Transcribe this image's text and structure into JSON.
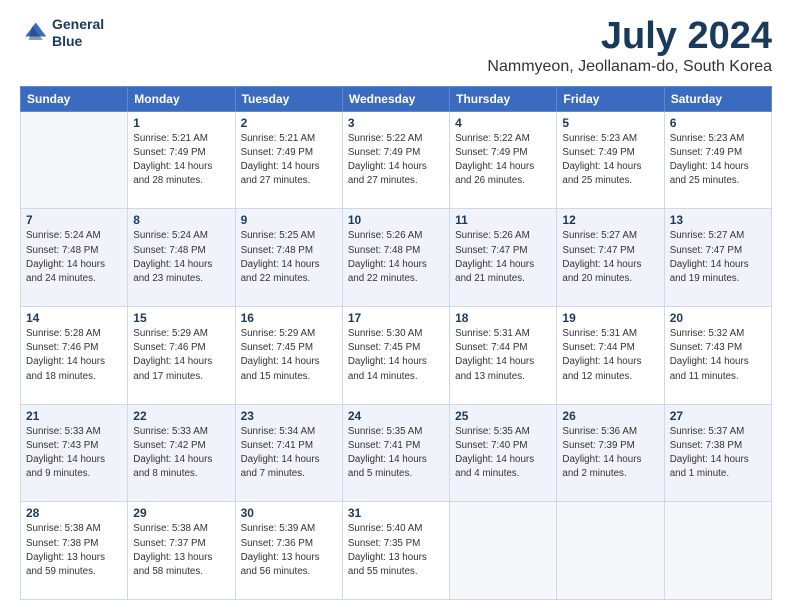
{
  "logo": {
    "line1": "General",
    "line2": "Blue"
  },
  "title": "July 2024",
  "subtitle": "Nammyeon, Jeollanam-do, South Korea",
  "headers": [
    "Sunday",
    "Monday",
    "Tuesday",
    "Wednesday",
    "Thursday",
    "Friday",
    "Saturday"
  ],
  "weeks": [
    [
      {
        "day": "",
        "info": ""
      },
      {
        "day": "1",
        "info": "Sunrise: 5:21 AM\nSunset: 7:49 PM\nDaylight: 14 hours\nand 28 minutes."
      },
      {
        "day": "2",
        "info": "Sunrise: 5:21 AM\nSunset: 7:49 PM\nDaylight: 14 hours\nand 27 minutes."
      },
      {
        "day": "3",
        "info": "Sunrise: 5:22 AM\nSunset: 7:49 PM\nDaylight: 14 hours\nand 27 minutes."
      },
      {
        "day": "4",
        "info": "Sunrise: 5:22 AM\nSunset: 7:49 PM\nDaylight: 14 hours\nand 26 minutes."
      },
      {
        "day": "5",
        "info": "Sunrise: 5:23 AM\nSunset: 7:49 PM\nDaylight: 14 hours\nand 25 minutes."
      },
      {
        "day": "6",
        "info": "Sunrise: 5:23 AM\nSunset: 7:49 PM\nDaylight: 14 hours\nand 25 minutes."
      }
    ],
    [
      {
        "day": "7",
        "info": "Sunrise: 5:24 AM\nSunset: 7:48 PM\nDaylight: 14 hours\nand 24 minutes."
      },
      {
        "day": "8",
        "info": "Sunrise: 5:24 AM\nSunset: 7:48 PM\nDaylight: 14 hours\nand 23 minutes."
      },
      {
        "day": "9",
        "info": "Sunrise: 5:25 AM\nSunset: 7:48 PM\nDaylight: 14 hours\nand 22 minutes."
      },
      {
        "day": "10",
        "info": "Sunrise: 5:26 AM\nSunset: 7:48 PM\nDaylight: 14 hours\nand 22 minutes."
      },
      {
        "day": "11",
        "info": "Sunrise: 5:26 AM\nSunset: 7:47 PM\nDaylight: 14 hours\nand 21 minutes."
      },
      {
        "day": "12",
        "info": "Sunrise: 5:27 AM\nSunset: 7:47 PM\nDaylight: 14 hours\nand 20 minutes."
      },
      {
        "day": "13",
        "info": "Sunrise: 5:27 AM\nSunset: 7:47 PM\nDaylight: 14 hours\nand 19 minutes."
      }
    ],
    [
      {
        "day": "14",
        "info": "Sunrise: 5:28 AM\nSunset: 7:46 PM\nDaylight: 14 hours\nand 18 minutes."
      },
      {
        "day": "15",
        "info": "Sunrise: 5:29 AM\nSunset: 7:46 PM\nDaylight: 14 hours\nand 17 minutes."
      },
      {
        "day": "16",
        "info": "Sunrise: 5:29 AM\nSunset: 7:45 PM\nDaylight: 14 hours\nand 15 minutes."
      },
      {
        "day": "17",
        "info": "Sunrise: 5:30 AM\nSunset: 7:45 PM\nDaylight: 14 hours\nand 14 minutes."
      },
      {
        "day": "18",
        "info": "Sunrise: 5:31 AM\nSunset: 7:44 PM\nDaylight: 14 hours\nand 13 minutes."
      },
      {
        "day": "19",
        "info": "Sunrise: 5:31 AM\nSunset: 7:44 PM\nDaylight: 14 hours\nand 12 minutes."
      },
      {
        "day": "20",
        "info": "Sunrise: 5:32 AM\nSunset: 7:43 PM\nDaylight: 14 hours\nand 11 minutes."
      }
    ],
    [
      {
        "day": "21",
        "info": "Sunrise: 5:33 AM\nSunset: 7:43 PM\nDaylight: 14 hours\nand 9 minutes."
      },
      {
        "day": "22",
        "info": "Sunrise: 5:33 AM\nSunset: 7:42 PM\nDaylight: 14 hours\nand 8 minutes."
      },
      {
        "day": "23",
        "info": "Sunrise: 5:34 AM\nSunset: 7:41 PM\nDaylight: 14 hours\nand 7 minutes."
      },
      {
        "day": "24",
        "info": "Sunrise: 5:35 AM\nSunset: 7:41 PM\nDaylight: 14 hours\nand 5 minutes."
      },
      {
        "day": "25",
        "info": "Sunrise: 5:35 AM\nSunset: 7:40 PM\nDaylight: 14 hours\nand 4 minutes."
      },
      {
        "day": "26",
        "info": "Sunrise: 5:36 AM\nSunset: 7:39 PM\nDaylight: 14 hours\nand 2 minutes."
      },
      {
        "day": "27",
        "info": "Sunrise: 5:37 AM\nSunset: 7:38 PM\nDaylight: 14 hours\nand 1 minute."
      }
    ],
    [
      {
        "day": "28",
        "info": "Sunrise: 5:38 AM\nSunset: 7:38 PM\nDaylight: 13 hours\nand 59 minutes."
      },
      {
        "day": "29",
        "info": "Sunrise: 5:38 AM\nSunset: 7:37 PM\nDaylight: 13 hours\nand 58 minutes."
      },
      {
        "day": "30",
        "info": "Sunrise: 5:39 AM\nSunset: 7:36 PM\nDaylight: 13 hours\nand 56 minutes."
      },
      {
        "day": "31",
        "info": "Sunrise: 5:40 AM\nSunset: 7:35 PM\nDaylight: 13 hours\nand 55 minutes."
      },
      {
        "day": "",
        "info": ""
      },
      {
        "day": "",
        "info": ""
      },
      {
        "day": "",
        "info": ""
      }
    ]
  ]
}
